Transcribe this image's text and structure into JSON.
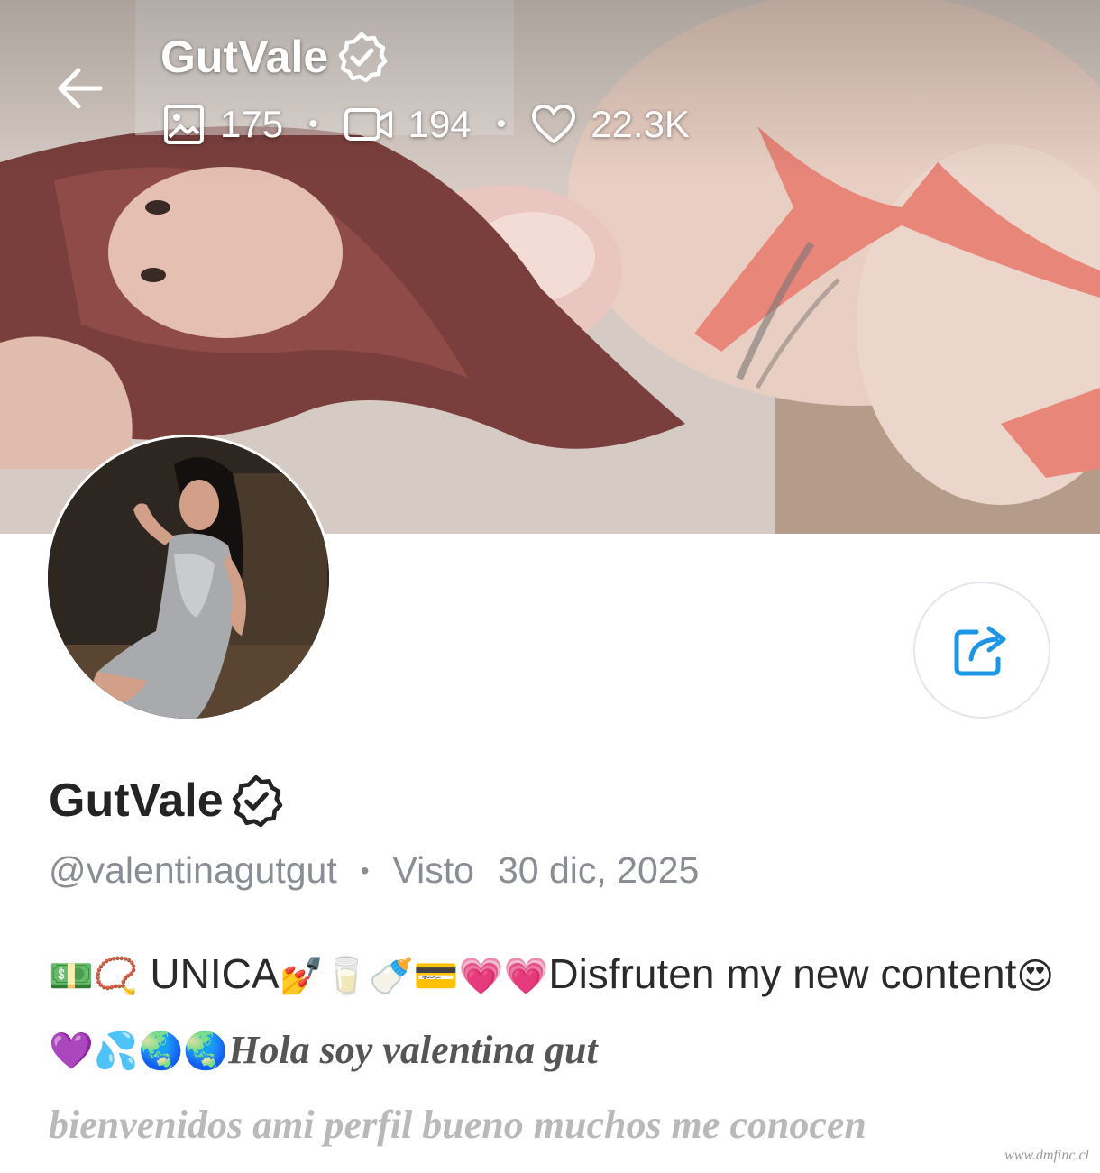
{
  "header": {
    "name": "GutVale",
    "stats": {
      "photos": "175",
      "videos": "194",
      "likes": "22.3K"
    }
  },
  "profile": {
    "name": "GutVale",
    "handle": "@valentinagutgut",
    "seen_label": "Visto",
    "seen_date": "30 dic, 2025"
  },
  "bio": {
    "emoji_lead": "💵📿",
    "text_1": " UNICA",
    "emoji_mid": "💅🥛🍼💳💗💗",
    "text_2": "Disfruten my new content",
    "emoji_tail": "😍💜💦🌏🌏",
    "fancy_1": "Hola soy valentina gut",
    "fancy_2": "bienvenidos ami perfil bueno muchos me conocen"
  },
  "watermark": "www.dmfinc.cl",
  "icons": {
    "back": "arrow-left-icon",
    "photos": "image-icon",
    "videos": "video-camera-icon",
    "likes": "heart-icon",
    "verified": "verified-badge-icon",
    "share": "share-icon"
  },
  "colors": {
    "share_icon": "#1e96e6",
    "handle_text": "#8a8e94",
    "name_text": "#242424"
  }
}
